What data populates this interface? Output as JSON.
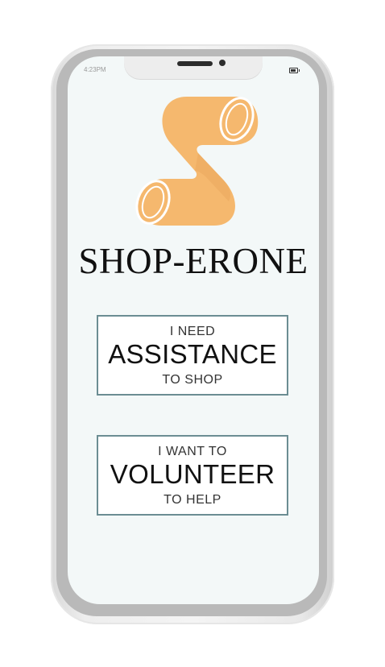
{
  "status_bar": {
    "time": "4:23PM",
    "battery_icon": "battery-icon"
  },
  "app": {
    "brand_name": "SHOP-ERONE",
    "logo_icon": "scroll-s-logo",
    "logo_color": "#f5b86e"
  },
  "buttons": {
    "assistance": {
      "line1": "I NEED",
      "line2": "ASSISTANCE",
      "line3": "TO SHOP"
    },
    "volunteer": {
      "line1": "I WANT TO",
      "line2": "VOLUNTEER",
      "line3": "TO HELP"
    }
  },
  "colors": {
    "screen_background": "#f3f8f8",
    "button_border": "#6b8d93"
  }
}
